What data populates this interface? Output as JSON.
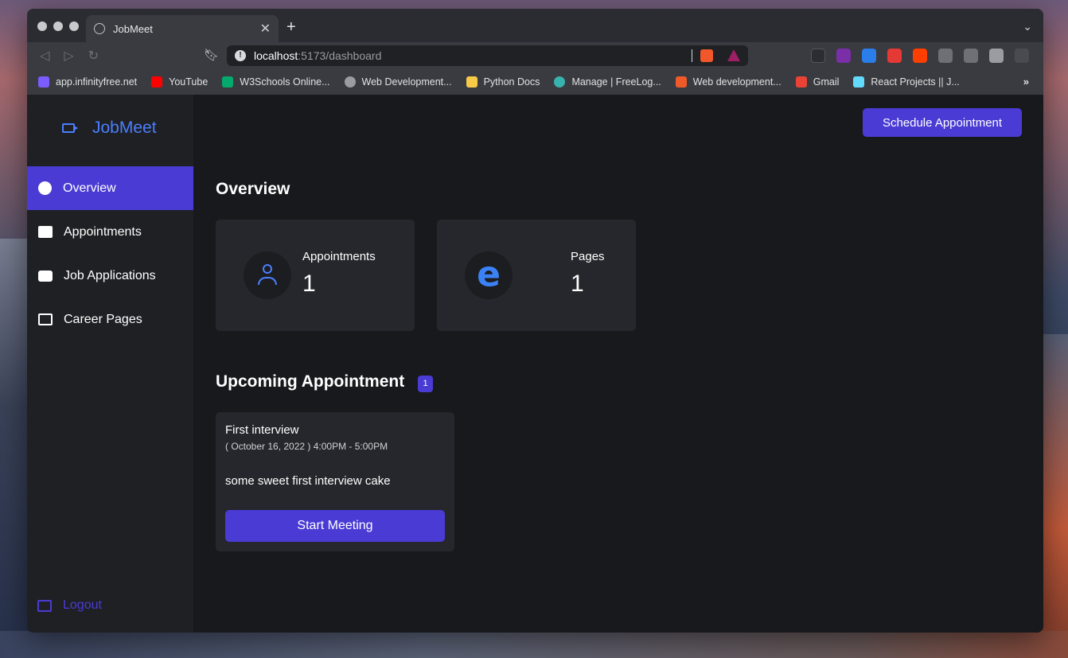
{
  "browser": {
    "tab_title": "JobMeet",
    "tab_close": "✕",
    "new_tab": "+",
    "url_host": "localhost",
    "url_path": ":5173/dashboard",
    "bookmarks": [
      {
        "label": "app.infinityfree.net",
        "color": "#7a5cff"
      },
      {
        "label": "YouTube",
        "color": "#ff0000"
      },
      {
        "label": "W3Schools Online...",
        "color": "#04aa6d"
      },
      {
        "label": "Web Development...",
        "color": "#9a9ca1"
      },
      {
        "label": "Python Docs",
        "color": "#f7c948"
      },
      {
        "label": "Manage | FreeLog...",
        "color": "#38b2ac"
      },
      {
        "label": "Web development...",
        "color": "#f05a28"
      },
      {
        "label": "Gmail",
        "color": "#ea4335"
      },
      {
        "label": "React Projects || J...",
        "color": "#61dafb"
      }
    ],
    "bookmarks_more": "»"
  },
  "sidebar": {
    "brand": "JobMeet",
    "items": [
      {
        "label": "Overview",
        "active": true
      },
      {
        "label": "Appointments",
        "active": false
      },
      {
        "label": "Job Applications",
        "active": false
      },
      {
        "label": "Career Pages",
        "active": false
      }
    ],
    "logout": "Logout"
  },
  "main": {
    "schedule_button": "Schedule Appointment",
    "overview_title": "Overview",
    "stats": [
      {
        "label": "Appointments",
        "value": "1",
        "icon": "person-icon"
      },
      {
        "label": "Pages",
        "value": "1",
        "icon": "edge-icon"
      }
    ],
    "upcoming_title": "Upcoming Appointment",
    "upcoming_count": "1",
    "appointment": {
      "title": "First interview",
      "datetime": "( October 16, 2022 ) 4:00PM - 5:00PM",
      "description": "some sweet first interview cake",
      "button": "Start Meeting"
    }
  },
  "colors": {
    "accent": "#4a3bd4",
    "brand_blue": "#4a7fff",
    "card_bg": "#25272c"
  }
}
